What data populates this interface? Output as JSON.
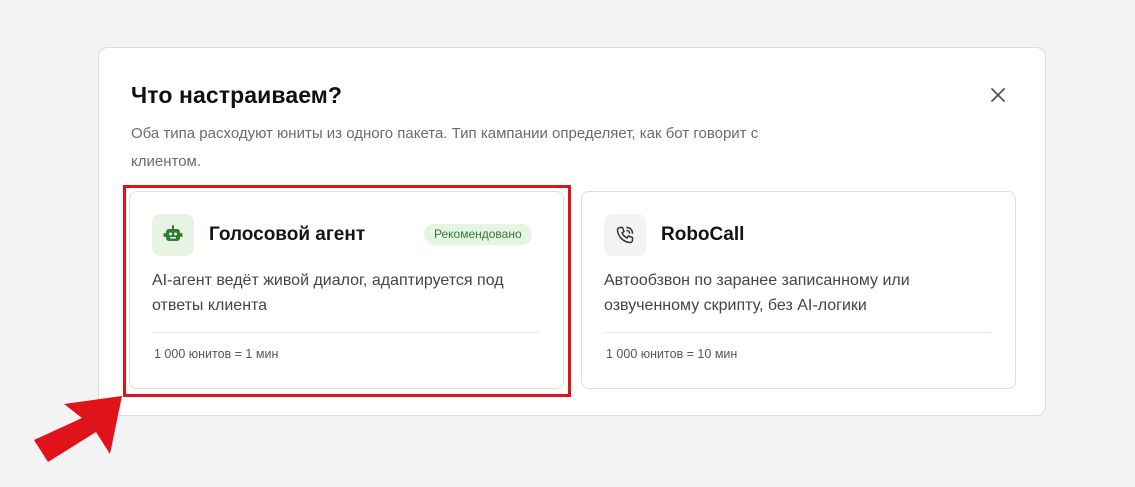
{
  "modal": {
    "title": "Что настраиваем?",
    "subtitle": "Оба типа расходуют юниты из одного пакета. Тип кампании определяет, как бот говорит с клиентом."
  },
  "cards": [
    {
      "id": "voice-agent",
      "icon": "robot-icon",
      "title": "Голосовой агент",
      "badge": "Рекомендовано",
      "description": "AI-агент ведёт живой диалог, адаптируется под ответы клиента",
      "cost": "1 000 юнитов = 1 мин"
    },
    {
      "id": "robocall",
      "icon": "phone-call-icon",
      "title": "RoboCall",
      "description": "Автообзвон по заранее записанному или озвученному скрипту, без AI-логики",
      "cost": "1 000 юнитов = 10 мин"
    }
  ],
  "colors": {
    "accent_green": "#2e7d32",
    "badge_bg": "#e8f4e3",
    "highlight_red": "#e0121a"
  }
}
